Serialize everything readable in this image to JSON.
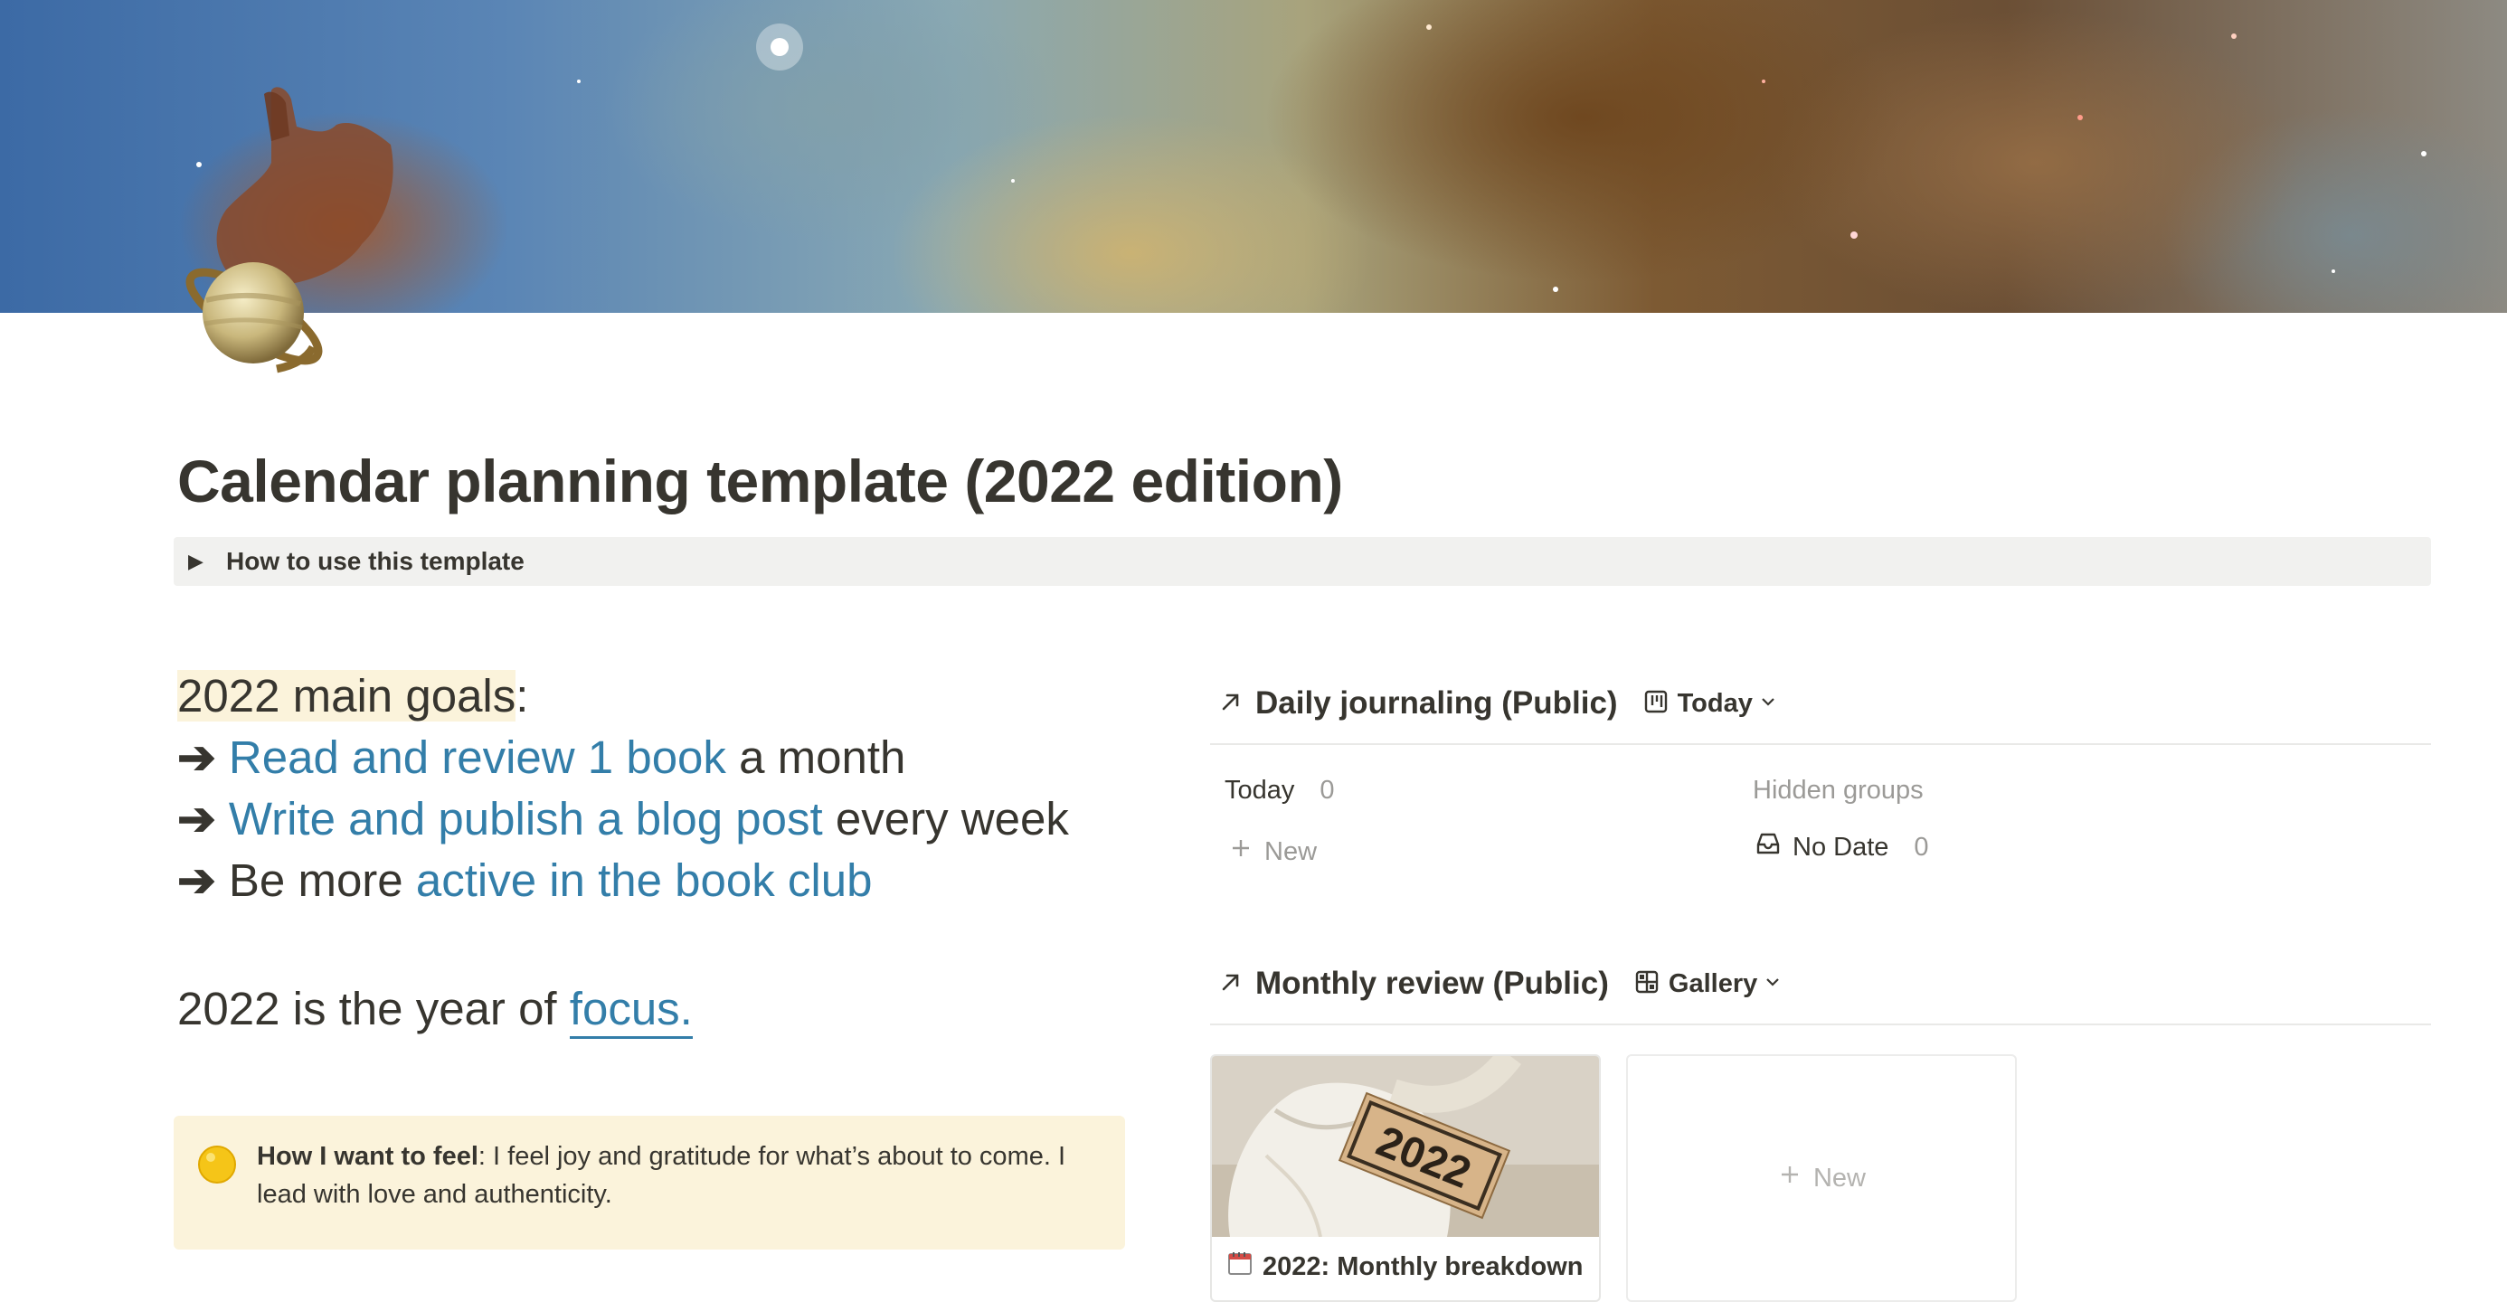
{
  "page": {
    "title": "Calendar planning template (2022 edition)",
    "cover_image": "nebula-cover",
    "icon": "ringed-planet-icon"
  },
  "toggle": {
    "label": "How to use this template"
  },
  "goals": {
    "heading": "2022 main goals",
    "heading_suffix": ":",
    "arrow": "➔",
    "items": [
      {
        "link": "Read and review 1 book",
        "suffix": " a month"
      },
      {
        "link": "Write and publish a blog post",
        "suffix": " every week"
      },
      {
        "prefix": "Be more ",
        "link": "active in the book club"
      }
    ]
  },
  "focus": {
    "prefix": "2022 is the year of ",
    "link": "focus."
  },
  "callout": {
    "icon": "sparkle-sun-icon",
    "bold": "How I want to feel",
    "text": ": I feel joy and gratitude for what’s about to come. I lead with love and authenticity."
  },
  "daily_journaling": {
    "title": "Daily journaling (Public)",
    "view": "Today",
    "view_icon": "board-view-icon",
    "groups": [
      {
        "name": "Today",
        "count": "0"
      }
    ],
    "new_label": "New",
    "hidden_groups_label": "Hidden groups",
    "hidden_groups": [
      {
        "name": "No Date",
        "count": "0",
        "icon": "inbox-icon"
      }
    ]
  },
  "monthly_review": {
    "title": "Monthly review (Public)",
    "view": "Gallery",
    "view_icon": "gallery-view-icon",
    "cards": [
      {
        "title": "2022: Monthly breakdown",
        "tag_text": "2022",
        "icon": "calendar-spiral-icon"
      }
    ],
    "new_label": "New"
  },
  "colors": {
    "link": "#337ea9",
    "highlight": "#fbf3db",
    "toggle_bg": "#f1f1ef",
    "text": "#37352f",
    "muted": "#9b9a97"
  }
}
